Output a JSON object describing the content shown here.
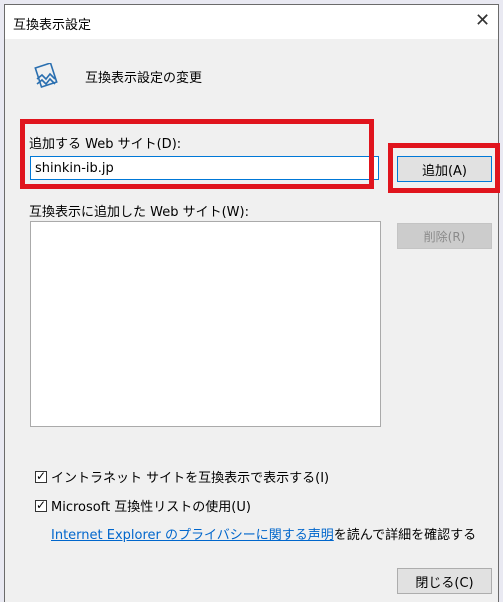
{
  "window": {
    "title": "互換表示設定",
    "close_glyph": "✕"
  },
  "header": {
    "icon": "compatibility-view-icon",
    "text": "互換表示設定の変更"
  },
  "add_section": {
    "label": "追加する Web サイト(D):",
    "input_value": "shinkin-ib.jp",
    "add_button_label": "追加(A)"
  },
  "added_section": {
    "label": "互換表示に追加した Web サイト(W):",
    "sites": [],
    "delete_button_label": "削除(R)"
  },
  "options": {
    "intranet_label": "イントラネット サイトを互換表示で表示する(I)",
    "intranet_checked": true,
    "ms_list_label": "Microsoft 互換性リストの使用(U)",
    "ms_list_checked": true
  },
  "privacy": {
    "link_text": "Internet Explorer のプライバシーに関する声明",
    "suffix_text": "を読んで詳細を確認する"
  },
  "footer": {
    "close_button_label": "閉じる(C)"
  },
  "colors": {
    "highlight": "#e0141d",
    "link": "#0066cc",
    "focus_border": "#0078d7"
  }
}
